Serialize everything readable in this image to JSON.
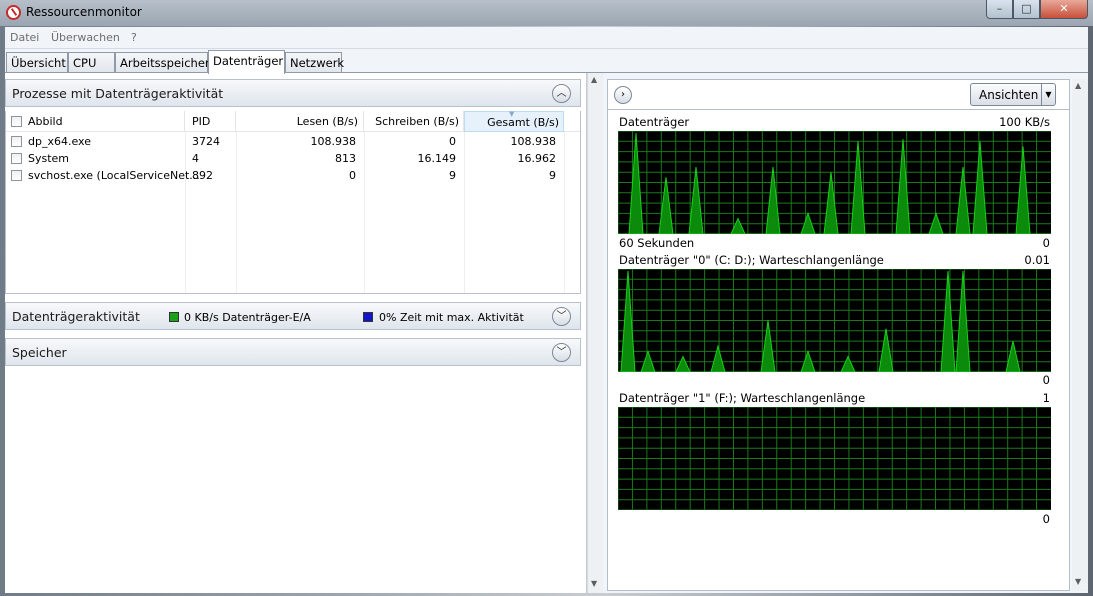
{
  "window": {
    "title": "Ressourcenmonitor",
    "min": "–",
    "max": "□",
    "close": "✕"
  },
  "menu": [
    "Datei",
    "Überwachen",
    "?"
  ],
  "tabs": [
    "Übersicht",
    "CPU",
    "Arbeitsspeicher",
    "Datenträger",
    "Netzwerk"
  ],
  "active_tab": "Datenträger",
  "processes": {
    "title": "Prozesse mit Datenträgeraktivität",
    "columns": [
      "Abbild",
      "PID",
      "Lesen (B/s)",
      "Schreiben (B/s)",
      "Gesamt (B/s)"
    ],
    "rows": [
      {
        "name": "dp_x64.exe",
        "pid": "3724",
        "read": "108.938",
        "write": "0",
        "total": "108.938"
      },
      {
        "name": "System",
        "pid": "4",
        "read": "813",
        "write": "16.149",
        "total": "16.962"
      },
      {
        "name": "svchost.exe (LocalServiceNet...",
        "pid": "892",
        "read": "0",
        "write": "9",
        "total": "9"
      }
    ]
  },
  "activity": {
    "title": "Datenträgeraktivität",
    "io_label": "0 KB/s Datenträger-E/A",
    "io_color": "#1aa31a",
    "active_label": "0% Zeit mit max. Aktivität",
    "active_color": "#1414c8"
  },
  "memory": {
    "title": "Speicher"
  },
  "graphs": {
    "expand_icon": "›",
    "view_button": "Ansichten",
    "disk": {
      "title": "Datenträger",
      "max": "100 KB/s",
      "time": "60 Sekunden",
      "min": "0"
    },
    "disk0": {
      "title": "Datenträger \"0\" (C: D:); Warteschlangenlänge",
      "max": "0.01",
      "min": "0"
    },
    "disk1": {
      "title": "Datenträger \"1\" (F:); Warteschlangenlänge",
      "max": "1",
      "min": "0"
    },
    "line_color": "#17d117",
    "grid_color": "#1a7a1a"
  }
}
